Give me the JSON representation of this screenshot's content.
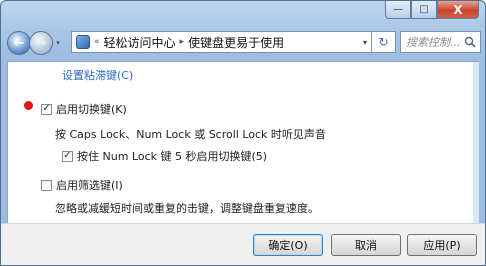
{
  "window": {
    "min_label": "—",
    "max_label": "□",
    "close_label": "X"
  },
  "nav": {
    "back_glyph": "←",
    "forward_glyph": "→",
    "dropdown_glyph": "▾",
    "address": {
      "prefix": "«",
      "crumb1": "轻松访问中心",
      "separator": "▸",
      "crumb2": "使键盘更易于使用",
      "dropdown_glyph": "▾"
    },
    "refresh_glyph": "↻",
    "search_placeholder": "搜索控制..."
  },
  "content": {
    "sticky_keys_link": "设置粘滞键(C)",
    "toggle_keys": {
      "label": "启用切换键(K)",
      "checked": true,
      "description": "按 Caps Lock、Num Lock 或 Scroll Lock 时听见声音",
      "sub_option": {
        "label": "按住 Num Lock 键 5 秒启用切换键(5)",
        "checked": true
      }
    },
    "filter_keys": {
      "label": "启用筛选键(I)",
      "checked": false,
      "description": "忽略或减缓短时间或重复的击键，调整键盘重复速度。"
    },
    "check_glyph": "✓"
  },
  "buttons": {
    "ok": "确定(O)",
    "cancel": "取消",
    "apply": "应用(P)"
  },
  "colors": {
    "link": "#2a6cc2",
    "marker": "#e01818",
    "title_bar": "#bcd6ee"
  }
}
